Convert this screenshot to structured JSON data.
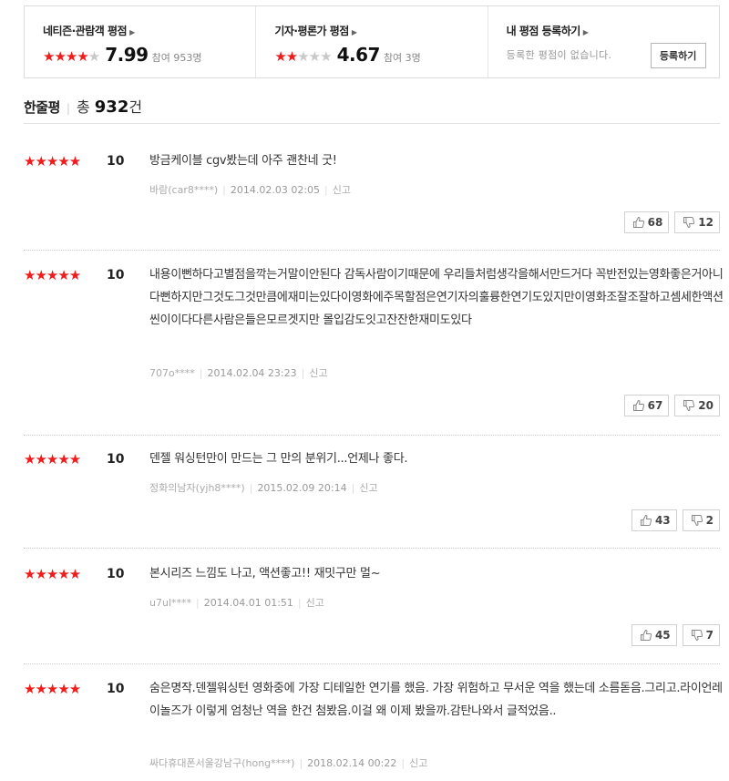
{
  "ratings": {
    "netizen": {
      "title": "네티즌·관람객 평점",
      "stars_on": "★★★★",
      "stars_off": "★",
      "score": "7.99",
      "count": "참여 953명"
    },
    "critic": {
      "title": "기자·평론가 평점",
      "stars_on": "★★",
      "stars_off": "★★★",
      "score": "4.67",
      "count": "참여 3명"
    },
    "mine": {
      "title": "내 평점 등록하기",
      "empty": "등록한 평점이 없습니다.",
      "button": "등록하기"
    }
  },
  "summary": {
    "label": "한줄평",
    "total_prefix": "총 ",
    "total": "932",
    "total_suffix": "건"
  },
  "reviews": [
    {
      "stars": "★★★★★",
      "score": "10",
      "text": "방금케이블 cgv봤는데 아주 괜찬네 굿!",
      "author": "바람(car8****)",
      "date": "2014.02.03 02:05",
      "report": "신고",
      "up": "68",
      "down": "12"
    },
    {
      "stars": "★★★★★",
      "score": "10",
      "text": "내용이뻔하다고별점을깍는거말이안된다 감독사람이기때문에 우리들처럼생각을해서만드거다 꼭반전있는영화좋은거아니다뻔하지만그것도그것만큼에재미는있다이영화에주목할점은연기자의훌륭한연기도있지만이영화조잘조잘하고셈세한액션씬이이다다른사람은들은모르겟지만 몰입감도잇고잔잔한재미도있다",
      "author": "707o****",
      "date": "2014.02.04 23:23",
      "report": "신고",
      "up": "67",
      "down": "20"
    },
    {
      "stars": "★★★★★",
      "score": "10",
      "text": "덴젤 워싱턴만이 만드는 그 만의 분위기...언제나 좋다.",
      "author": "정화의남자(yjh8****)",
      "date": "2015.02.09 20:14",
      "report": "신고",
      "up": "43",
      "down": "2"
    },
    {
      "stars": "★★★★★",
      "score": "10",
      "text": "본시리즈 느낌도 나고, 액션좋고!! 재밋구만 멀~",
      "author": "u7ul****",
      "date": "2014.04.01 01:51",
      "report": "신고",
      "up": "45",
      "down": "7"
    },
    {
      "stars": "★★★★★",
      "score": "10",
      "text": "숨은명작.덴젤워싱턴 영화중에 가장 디테일한 연기를 했음. 가장 위험하고 무서운 역을 했는데 소름돋음.그리고.라이언레이놀즈가 이렇게 엄청난 역을 한건 첨봤음.이걸 왜 이제 봤을까.감탄나와서 글적었음..",
      "author": "싸다휴대폰서울강남구(hong****)",
      "date": "2018.02.14 00:22",
      "report": "신고",
      "up": "",
      "down": ""
    }
  ]
}
